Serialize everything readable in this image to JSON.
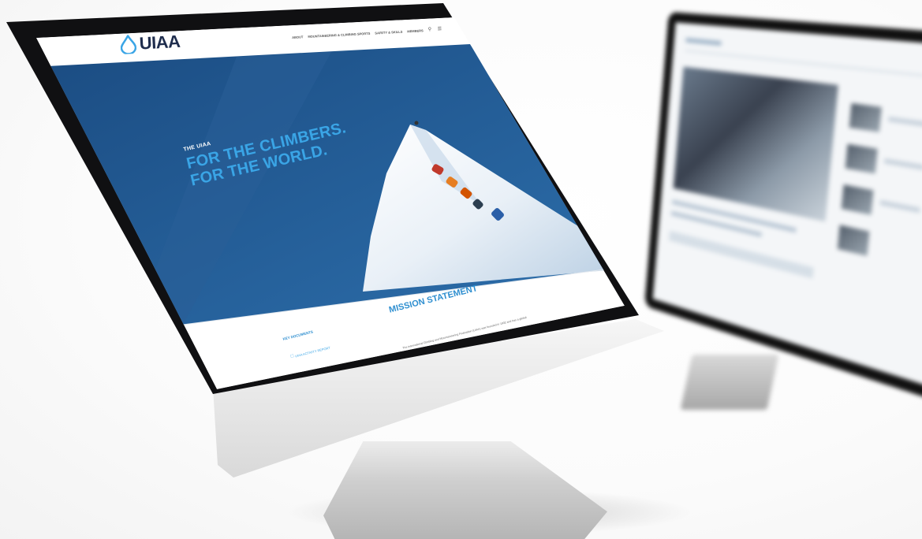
{
  "site": {
    "logo_text": "UIAA",
    "nav": {
      "items": [
        "ABOUT",
        "MOUNTAINEERING & CLIMBING SPORTS",
        "SAFETY & SKILLS",
        "MEMBERS"
      ],
      "icons": [
        "search-icon",
        "menu-icon"
      ]
    },
    "hero": {
      "kicker": "THE UIAA",
      "headline_line1": "FOR THE CLIMBERS.",
      "headline_line2": "FOR THE WORLD."
    },
    "mission": {
      "title": "MISSION STATEMENT",
      "body": "The International Climbing and Mountaineering Federation (UIAA) was founded in 1932 and has a global"
    },
    "key_documents": {
      "title": "KEY DOCUMENTS",
      "link_label": "UIAA ACTIVITY REPORT"
    }
  },
  "colors": {
    "hero_blue": "#1c4f86",
    "accent_blue": "#3aa5e6",
    "title_blue": "#2f8fd0",
    "logo_navy": "#1f2d4d"
  }
}
